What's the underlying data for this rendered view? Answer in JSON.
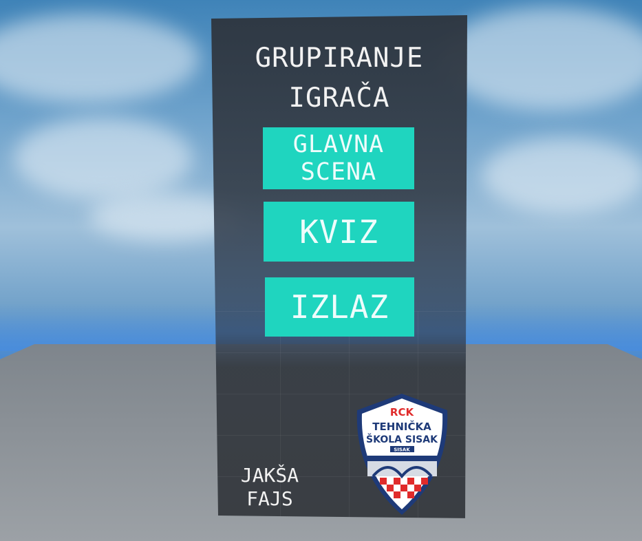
{
  "menu": {
    "title_line1": "GRUPIRANJE",
    "title_line2": "IGRAČA",
    "buttons": {
      "main_scene_line1": "GLAVNA",
      "main_scene_line2": "SCENA",
      "quiz": "KVIZ",
      "exit": "IZLAZ"
    },
    "author_line1": "JAKŠA",
    "author_line2": "FAJS"
  },
  "logo": {
    "top_text": "RCK",
    "line1": "TEHNIČKA",
    "line2": "ŠKOLA SISAK",
    "ribbon": "SISAK"
  },
  "colors": {
    "button": "#1fd5bf",
    "panel": "#2e3640",
    "logo_red": "#e02b2b",
    "logo_navy": "#1e3a78"
  }
}
